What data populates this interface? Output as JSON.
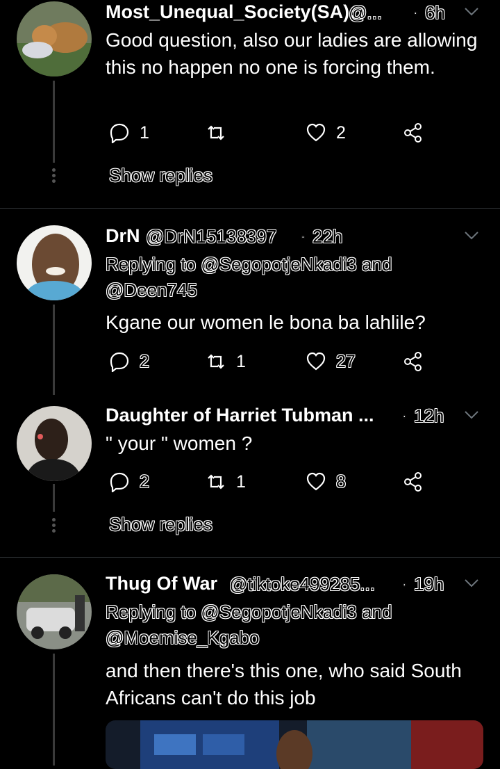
{
  "tweets": [
    {
      "name": "Most_Unequal_Society(SA).",
      "handle": "@...",
      "time": "6h",
      "text": "Good question, also our ladies are allowing this no happen no one is forcing them.",
      "replies": "1",
      "retweets": "",
      "likes": "2",
      "show_replies": "Show replies"
    },
    {
      "name": "DrN",
      "handle": "@DrN15138397",
      "time": "22h",
      "replying_to": "Replying to @SegopotjeNkadi3 and",
      "replying_to_2": "@Deen745",
      "text": "Kgane our women le bona ba lahlile?",
      "replies": "2",
      "retweets": "1",
      "likes": "27"
    },
    {
      "name": "Daughter of Harriet Tubman ...",
      "handle": "",
      "time": "12h",
      "text": "\" your \" women ?",
      "replies": "2",
      "retweets": "1",
      "likes": "8",
      "show_replies": "Show replies"
    },
    {
      "name": "Thug Of War",
      "handle": "@tiktoke499285...",
      "time": "19h",
      "replying_to": "Replying to @SegopotjeNkadi3 and",
      "replying_to_2": "@Moemise_Kgabo",
      "text": "and then there's this one, who said South Africans can't do this job"
    }
  ],
  "separator": "·"
}
